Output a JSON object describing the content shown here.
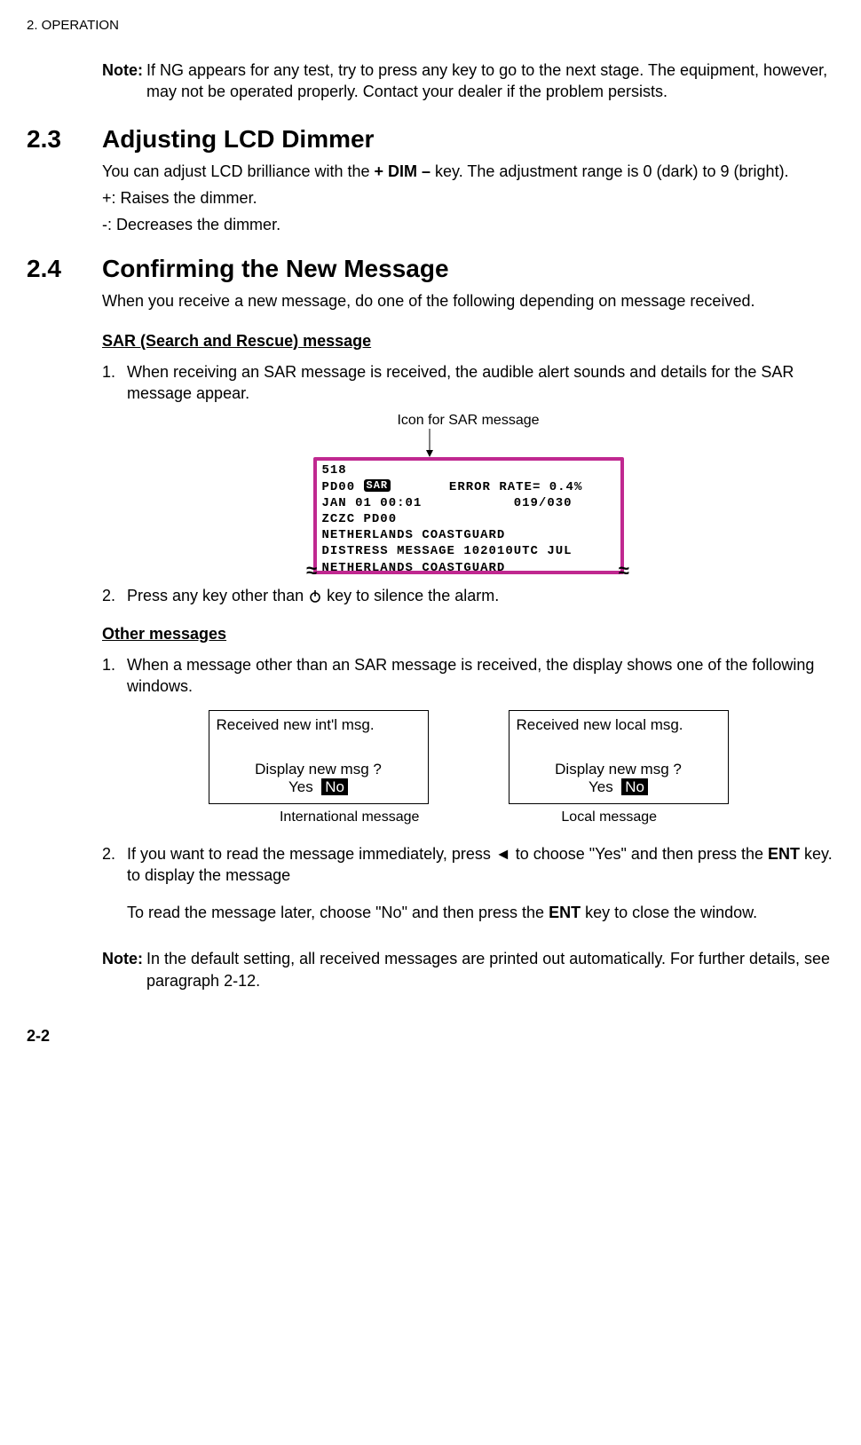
{
  "header": "2. OPERATION",
  "note1": {
    "label": "Note:",
    "body": "If NG appears for any test, try to press any key to go to the next stage. The equipment, however, may not be operated properly. Contact your dealer if the problem persists."
  },
  "sec23": {
    "num": "2.3",
    "title": "Adjusting LCD Dimmer",
    "p1a": "You can adjust LCD brilliance with the ",
    "p1key": "+ DIM –",
    "p1b": " key. The adjustment range is 0 (dark) to 9 (bright).",
    "p2": "+: Raises the dimmer.",
    "p3": "-: Decreases the dimmer."
  },
  "sec24": {
    "num": "2.4",
    "title": "Confirming the New Message",
    "intro": "When you receive a new message, do one of the following depending on message received.",
    "sarHeading": "SAR (Search and Rescue) message",
    "sar1": "When receiving an SAR message is received, the audible alert sounds and details for the SAR message appear.",
    "sarCaption": "Icon for SAR message",
    "lcd": {
      "l1a": "518",
      "l2a": "PD00 ",
      "l2badge": "SAR",
      "l2b": "       ERROR RATE= 0.4%",
      "l3": "JAN 01 00:01           019/030",
      "l4": "ZCZC PD00",
      "l5": "NETHERLANDS COASTGUARD",
      "l6": "DISTRESS MESSAGE 102010UTC JUL",
      "l7": "NETHERLANDS COASTGUARD"
    },
    "sar2a": "Press any key other than ",
    "sar2b": " key to silence the alarm.",
    "otherHeading": "Other messages",
    "other1": "When a message other than an SAR message is received, the display shows one of the following windows.",
    "dlgIntl": {
      "title": "Received new int'l msg.",
      "prompt": "Display new msg ?",
      "yes": "Yes",
      "no": "No",
      "caption": "International message"
    },
    "dlgLocal": {
      "title": "Received new local msg.",
      "prompt": "Display new msg ?",
      "yes": "Yes",
      "no": "No",
      "caption": "Local message"
    },
    "other2a": "If you want to read the message immediately, press ",
    "other2arrow": "◄",
    "other2b": " to choose \"Yes\" and then press the ",
    "other2ent": "ENT",
    "other2c": " key. to display the message",
    "other2d": "To read the message later, choose \"No\" and then press the ",
    "other2e": " key to close the window.",
    "note2label": "Note:",
    "note2body": "In the default setting, all received messages are printed out automatically. For further details, see paragraph 2-12."
  },
  "pageNum": "2-2"
}
